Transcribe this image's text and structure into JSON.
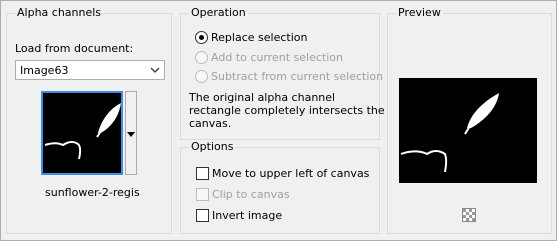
{
  "alpha": {
    "title": "Alpha channels",
    "load_label": "Load from document:",
    "document_value": "Image63",
    "channel_name": "sunflower-2-regis"
  },
  "operation": {
    "title": "Operation",
    "options": [
      "Replace selection",
      "Add to current selection",
      "Subtract from current selection"
    ],
    "selected": "Replace selection",
    "message": [
      "The original alpha channel",
      "rectangle completely intersects the",
      "canvas."
    ]
  },
  "options": {
    "title": "Options",
    "items": [
      "Move to upper left of canvas",
      "Clip to canvas",
      "Invert image"
    ]
  },
  "preview": {
    "title": "Preview"
  },
  "icons": {
    "combo_arrow": "chevron-down-icon",
    "thumb_menu": "dropdown-triangle-icon",
    "transparency": "checkerboard-icon"
  },
  "colors": {
    "accent": "#3c8fe3"
  }
}
